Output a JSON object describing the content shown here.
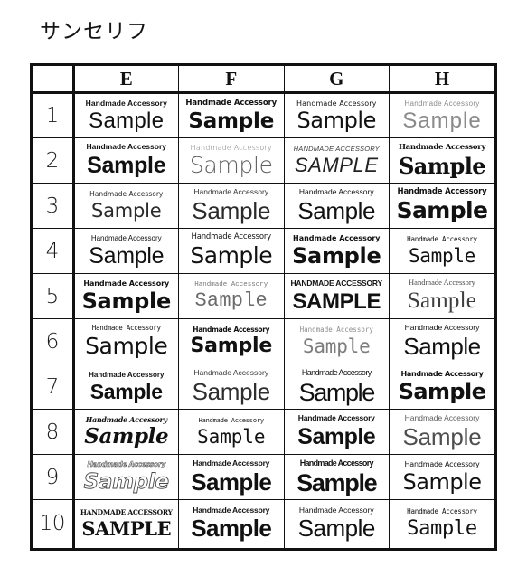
{
  "page": {
    "title": "サンセリフ",
    "background_color": "#ffffff",
    "text_color": "#111111",
    "border_color": "#111111"
  },
  "table": {
    "corner_label": "",
    "column_headers": [
      "E",
      "F",
      "G",
      "H"
    ],
    "row_labels": [
      "1",
      "2",
      "3",
      "4",
      "5",
      "6",
      "7",
      "8",
      "9",
      "10"
    ],
    "specimen_kicker_default": "Handmade Accessory",
    "specimen_word_default": "Sample",
    "rows": [
      {
        "label": "1",
        "cells": [
          {
            "column": "E",
            "kicker": "Handmade Accessory",
            "word": "Sample"
          },
          {
            "column": "F",
            "kicker": "Handmade Accessory",
            "word": "Sample"
          },
          {
            "column": "G",
            "kicker": "Handmade Accessory",
            "word": "Sample"
          },
          {
            "column": "H",
            "kicker": "Handmade Accessory",
            "word": "Sample"
          }
        ]
      },
      {
        "label": "2",
        "cells": [
          {
            "column": "E",
            "kicker": "Handmade Accessory",
            "word": "Sample"
          },
          {
            "column": "F",
            "kicker": "Handmade Accessory",
            "word": "Sample"
          },
          {
            "column": "G",
            "kicker": "HANDMADE ACCESSORY",
            "word": "SAMPLE"
          },
          {
            "column": "H",
            "kicker": "Handmade Accessory",
            "word": "Sample"
          }
        ]
      },
      {
        "label": "3",
        "cells": [
          {
            "column": "E",
            "kicker": "Handmade Accessory",
            "word": "Sample"
          },
          {
            "column": "F",
            "kicker": "Handmade Accessory",
            "word": "Sample"
          },
          {
            "column": "G",
            "kicker": "Handmade Accessory",
            "word": "Sample"
          },
          {
            "column": "H",
            "kicker": "Handmade Accessory",
            "word": "Sample"
          }
        ]
      },
      {
        "label": "4",
        "cells": [
          {
            "column": "E",
            "kicker": "Handmade Accessory",
            "word": "Sample"
          },
          {
            "column": "F",
            "kicker": "Handmade Accessory",
            "word": "Sample"
          },
          {
            "column": "G",
            "kicker": "Handmade Accessory",
            "word": "Sample"
          },
          {
            "column": "H",
            "kicker": "Handmade Accessory",
            "word": "Sample"
          }
        ]
      },
      {
        "label": "5",
        "cells": [
          {
            "column": "E",
            "kicker": "Handmade Accessory",
            "word": "Sample"
          },
          {
            "column": "F",
            "kicker": "Handmade Accessory",
            "word": "Sample"
          },
          {
            "column": "G",
            "kicker": "HANDMADE ACCESSORY",
            "word": "SAMPLE"
          },
          {
            "column": "H",
            "kicker": "Handmade Accessory",
            "word": "Sample"
          }
        ]
      },
      {
        "label": "6",
        "cells": [
          {
            "column": "E",
            "kicker": "Handmade Accessory",
            "word": "Sample"
          },
          {
            "column": "F",
            "kicker": "Handmade Accessory",
            "word": "Sample"
          },
          {
            "column": "G",
            "kicker": "Handmade Accessory",
            "word": "Sample"
          },
          {
            "column": "H",
            "kicker": "Handmade Accessory",
            "word": "Sample"
          }
        ]
      },
      {
        "label": "7",
        "cells": [
          {
            "column": "E",
            "kicker": "Handmade Accessory",
            "word": "Sample"
          },
          {
            "column": "F",
            "kicker": "Handmade Accessory",
            "word": "Sample"
          },
          {
            "column": "G",
            "kicker": "Handmade Accessory",
            "word": "Sample"
          },
          {
            "column": "H",
            "kicker": "Handmade Accessory",
            "word": "Sample"
          }
        ]
      },
      {
        "label": "8",
        "cells": [
          {
            "column": "E",
            "kicker": "Handmade Accessory",
            "word": "Sample"
          },
          {
            "column": "F",
            "kicker": "Handmade Accessory",
            "word": "Sample"
          },
          {
            "column": "G",
            "kicker": "Handmade Accessory",
            "word": "Sample"
          },
          {
            "column": "H",
            "kicker": "Handmade Accessory",
            "word": "Sample"
          }
        ]
      },
      {
        "label": "9",
        "cells": [
          {
            "column": "E",
            "kicker": "Handmade Accessory",
            "word": "Sample"
          },
          {
            "column": "F",
            "kicker": "Handmade Accessory",
            "word": "Sample"
          },
          {
            "column": "G",
            "kicker": "Handmade Accessory",
            "word": "Sample"
          },
          {
            "column": "H",
            "kicker": "Handmade Accessory",
            "word": "Sample"
          }
        ]
      },
      {
        "label": "10",
        "cells": [
          {
            "column": "E",
            "kicker": "HANDMADE ACCESSORY",
            "word": "SAMPLE"
          },
          {
            "column": "F",
            "kicker": "Handmade Accessory",
            "word": "Sample"
          },
          {
            "column": "G",
            "kicker": "Handmade Accessory",
            "word": "Sample"
          },
          {
            "column": "H",
            "kicker": "Handmade Accessory",
            "word": "Sample"
          }
        ]
      }
    ]
  }
}
